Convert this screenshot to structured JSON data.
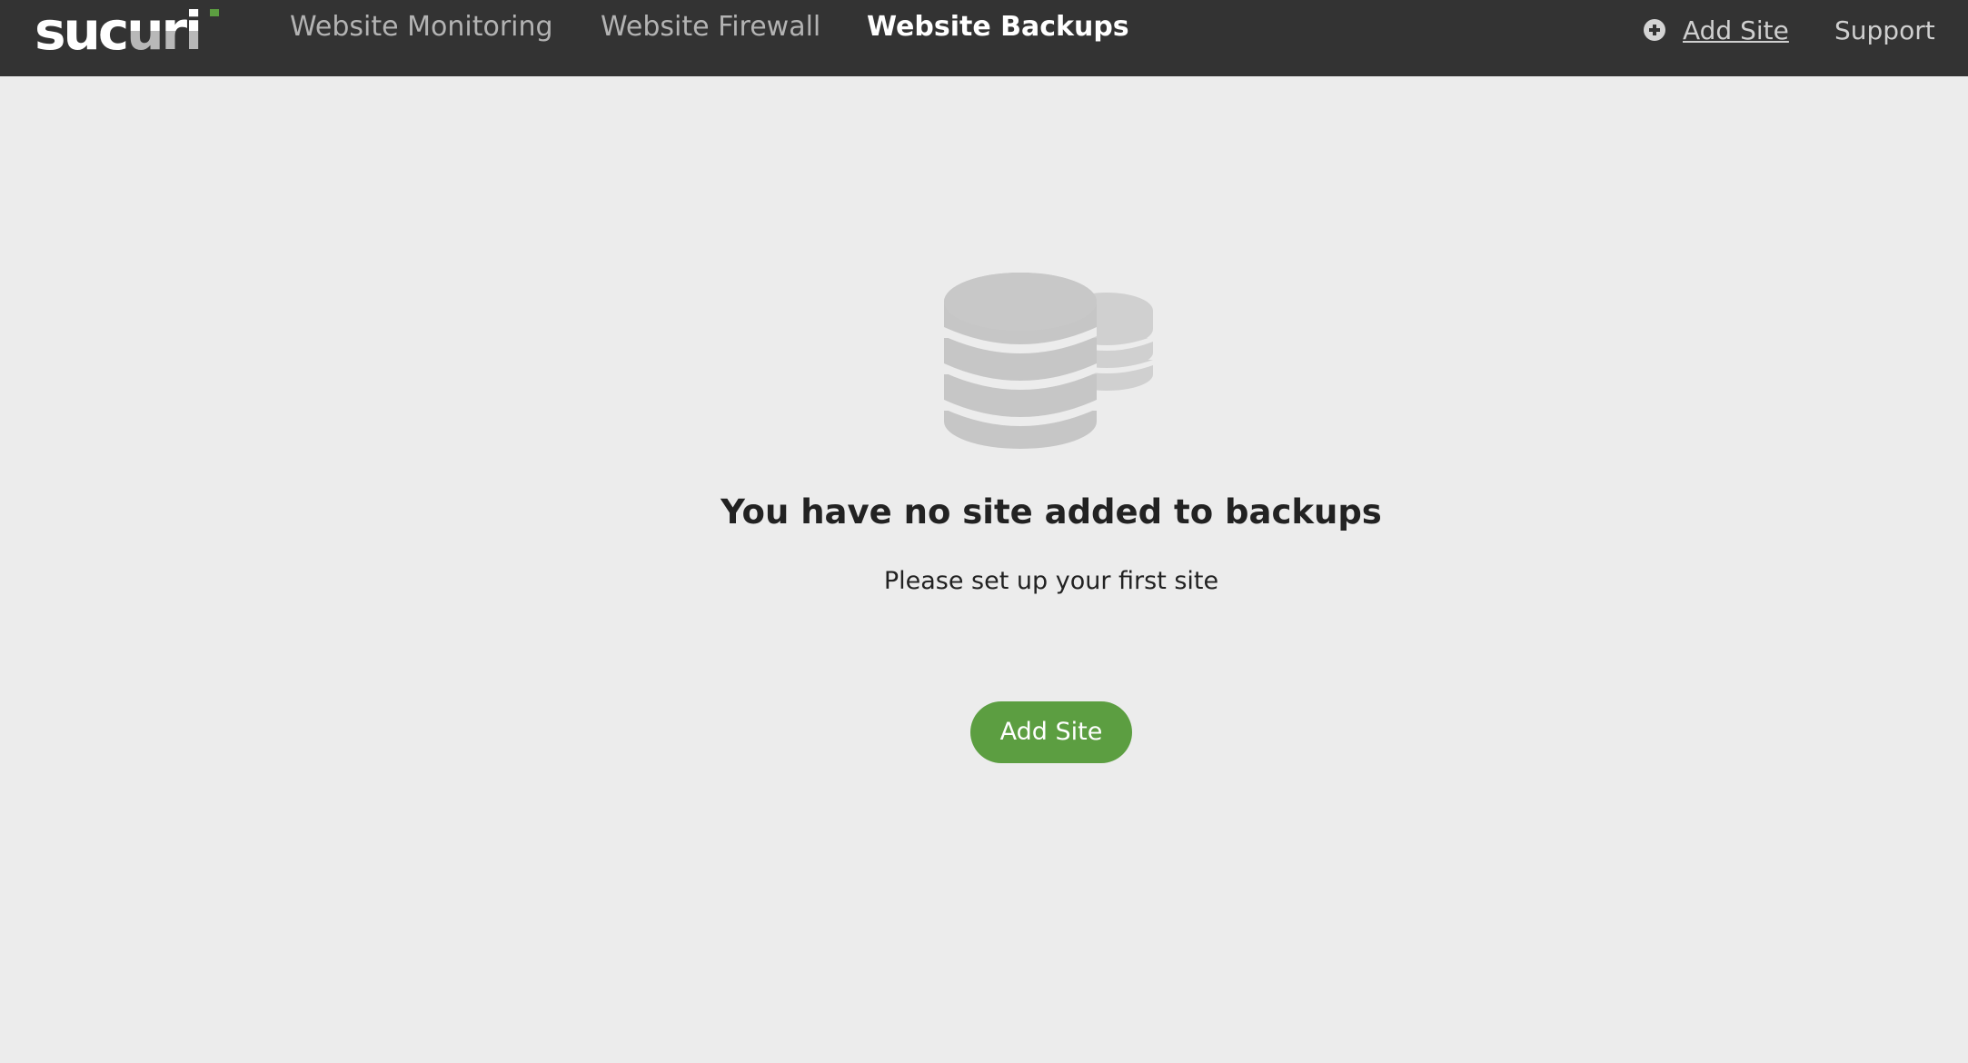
{
  "brand": {
    "logo_text": "sucuri",
    "accent_color": "#5c9e41",
    "topbar_color": "#333333"
  },
  "nav": {
    "tabs": [
      {
        "label": "Website Monitoring",
        "active": false
      },
      {
        "label": "Website Firewall",
        "active": false
      },
      {
        "label": "Website Backups",
        "active": true
      }
    ],
    "add_site_label": "Add Site",
    "add_site_icon": "plus-circle-icon",
    "support_label": "Support"
  },
  "empty_state": {
    "icon": "database-icon",
    "title": "You have no site added to backups",
    "subtitle": "Please set up your first site",
    "button_label": "Add Site"
  }
}
